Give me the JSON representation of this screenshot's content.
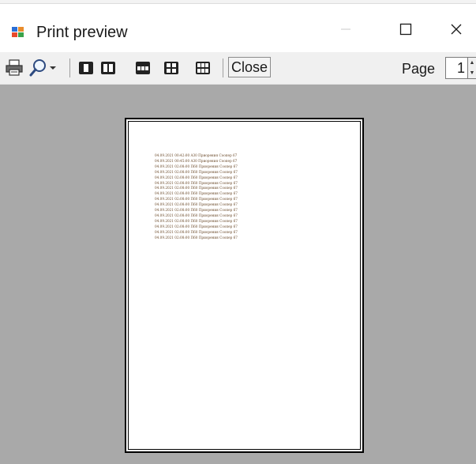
{
  "window": {
    "title": "Print preview",
    "controls": {
      "minimize_icon": "minimize-icon",
      "maximize_icon": "maximize-icon",
      "close_icon": "close-icon"
    }
  },
  "toolbar": {
    "print_icon": "printer-icon",
    "zoom_icon": "magnifier-icon",
    "layouts": [
      "one-page",
      "two-pages",
      "three-pages",
      "four-pages",
      "six-pages"
    ],
    "close_label": "Close",
    "page_label": "Page",
    "page_value": "1"
  },
  "preview": {
    "lines": [
      "04.09.2021 00:42:00 A30 Приорения Соопер 67",
      "04.09.2021 00:45:00 A30 Приорения Соопер 67",
      "04.09.2021 02:08:00 П60 Приорения Соопер 67",
      "04.09.2021 02:08:00 П60 Приорения Соопер 67",
      "04.09.2021 02:08:00 П60 Приорения Соопер 67",
      "04.09.2021 02:08:00 П60 Приорения Соопер 67",
      "04.09.2021 02:08:00 П60 Приорения Соопер 67",
      "04.09.2021 02:08:00 П60 Приорения Соопер 67",
      "04.09.2021 02:08:00 П60 Приорения Соопер 67",
      "04.09.2021 02:08:00 П60 Приорения Соопер 67",
      "04.09.2021 02:08:00 П60 Приорения Соопер 67",
      "04.09.2021 02:08:00 П60 Приорения Соопер 67",
      "04.09.2021 02:08:00 П60 Приорения Соопер 67",
      "04.09.2021 02:08:00 П60 Приорения Соопер 67",
      "04.09.2021 02:08:00 П60 Приорения Соопер 67",
      "04.09.2021 02:08:00 П60 Приорения Соопер 67"
    ]
  }
}
